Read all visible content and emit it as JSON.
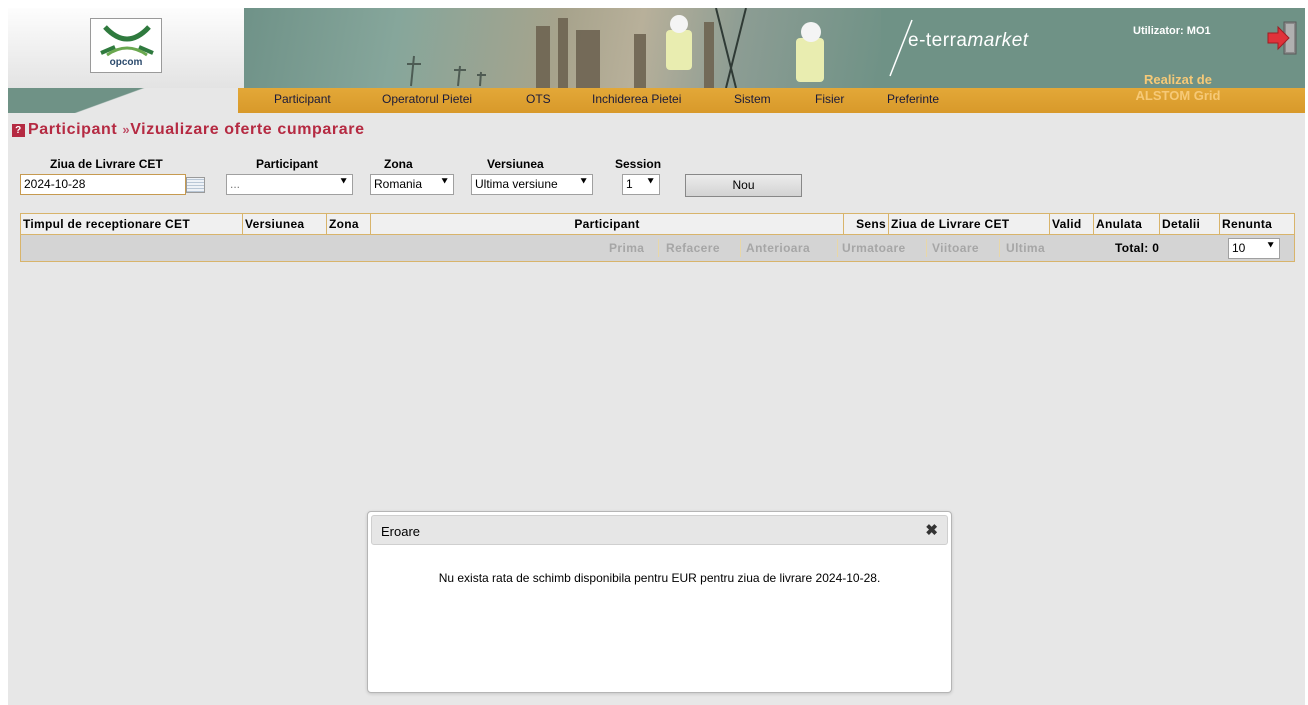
{
  "header": {
    "logo_text": "opcom",
    "brand": "e-terramarket",
    "brand_prefix": "e-terra",
    "brand_suffix": "market",
    "user_label": "Utilizator: MO1",
    "realizat_line1": "Realizat de",
    "realizat_line2": "ALSTOM Grid"
  },
  "menu": [
    "Participant",
    "Operatorul Pietei",
    "OTS",
    "Inchiderea Pietei",
    "Sistem",
    "Fisier",
    "Preferinte"
  ],
  "page": {
    "title_part1": "Participant",
    "title_sep": "»",
    "title_part2": "Vizualizare oferte cumparare",
    "help": "?"
  },
  "filters": {
    "date_label": "Ziua de Livrare CET",
    "date_value": "2024-10-28",
    "participant_label": "Participant",
    "participant_value": "...",
    "zona_label": "Zona",
    "zona_value": "Romania",
    "versiunea_label": "Versiunea",
    "versiunea_value": "Ultima versiune",
    "session_label": "Session",
    "session_value": "1",
    "new_button": "Nou"
  },
  "table": {
    "columns": [
      "Timpul de receptionare CET",
      "Versiunea",
      "Zona",
      "Participant",
      "Sens",
      "Ziua de Livrare CET",
      "Valid",
      "Anulata",
      "Detalii",
      "Renunta"
    ]
  },
  "pager": {
    "first": "Prima",
    "refresh": "Refacere",
    "previous": "Anterioara",
    "next": "Urmatoare",
    "future": "Viitoare",
    "last": "Ultima",
    "total": "Total: 0",
    "page_size": "10"
  },
  "dialog": {
    "title": "Eroare",
    "close": "✖",
    "message": "Nu exista rata de schimb disponibila pentru EUR pentru ziua de livrare 2024-10-28."
  },
  "colors": {
    "accent": "#d8992a",
    "banner": "#6f9286",
    "title": "#b52a42",
    "background": "#e7e7e7"
  },
  "icons": [
    "opcom-logo-icon",
    "logout-arrow-icon",
    "help-icon",
    "calendar-icon",
    "chevron-down-icon",
    "close-icon"
  ]
}
